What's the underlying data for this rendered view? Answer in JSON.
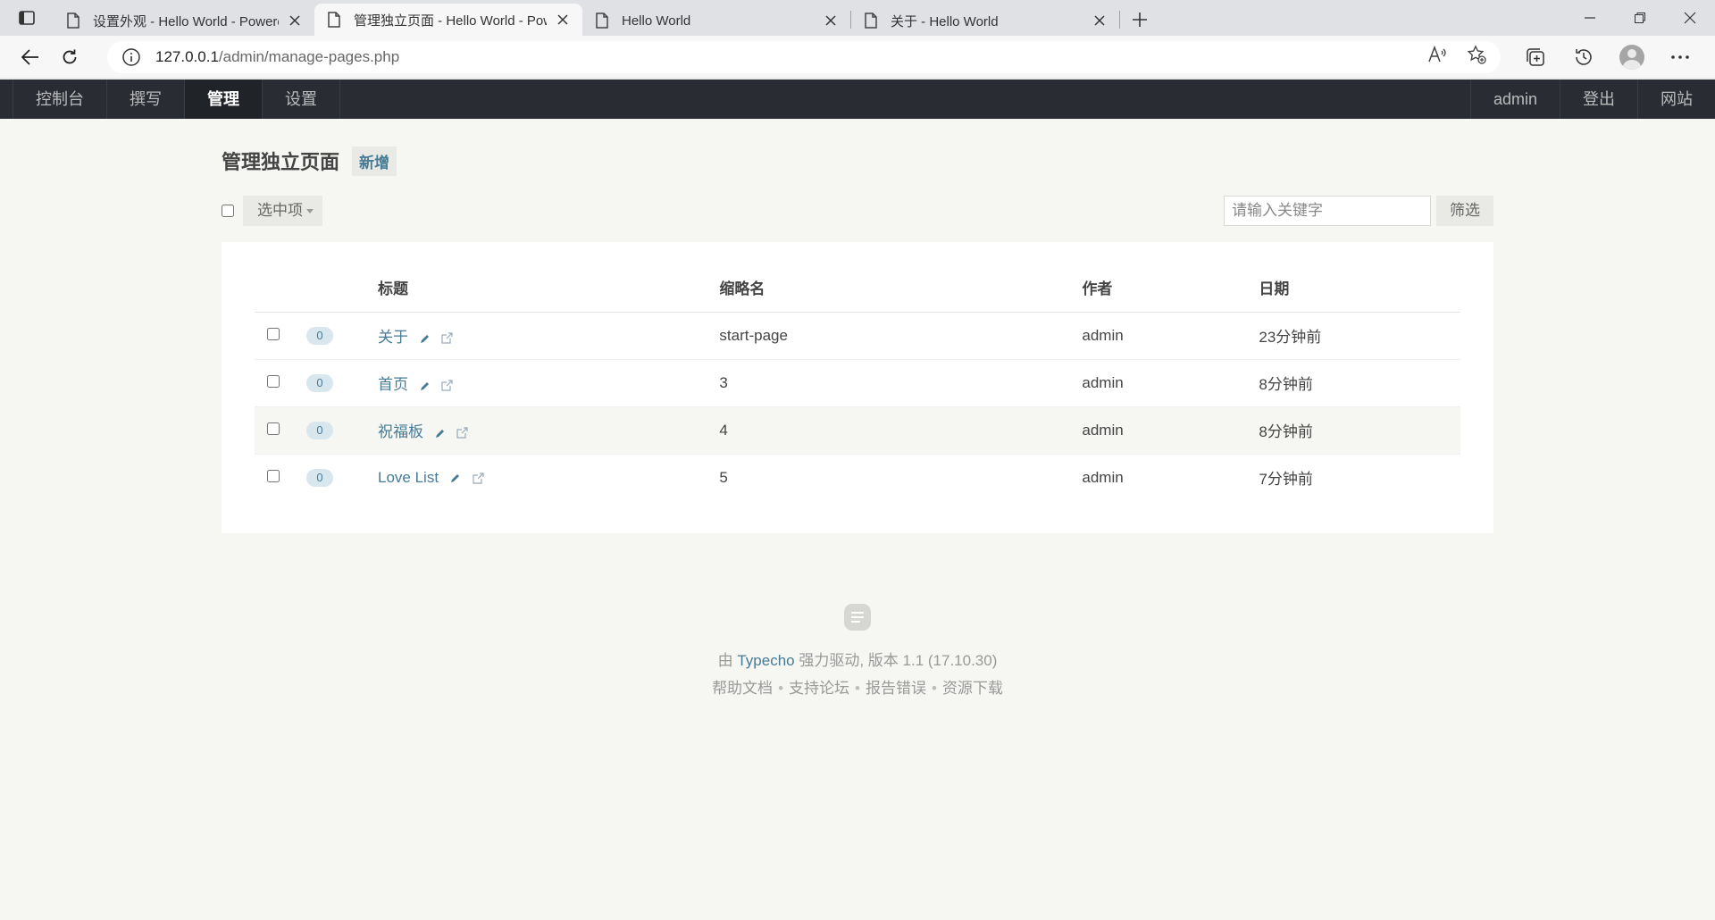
{
  "browser": {
    "tabs": [
      {
        "title": "设置外观 - Hello World - Powered by Typecho",
        "active": false
      },
      {
        "title": "管理独立页面 - Hello World - Powered by Typecho",
        "active": true
      },
      {
        "title": "Hello World",
        "active": false
      },
      {
        "title": "关于 - Hello World",
        "active": false
      }
    ],
    "url_host": "127.0.0.1",
    "url_path": "/admin/manage-pages.php"
  },
  "adminnav": {
    "left": [
      "控制台",
      "撰写",
      "管理",
      "设置"
    ],
    "active": "管理",
    "right": [
      "admin",
      "登出",
      "网站"
    ]
  },
  "page": {
    "title": "管理独立页面",
    "add_label": "新增",
    "selected_label": "选中项",
    "search_placeholder": "请输入关键字",
    "filter_label": "筛选"
  },
  "table": {
    "headers": {
      "title": "标题",
      "slug": "缩略名",
      "author": "作者",
      "date": "日期"
    },
    "rows": [
      {
        "count": "0",
        "title": "关于",
        "slug": "start-page",
        "author": "admin",
        "date": "23分钟前"
      },
      {
        "count": "0",
        "title": "首页",
        "slug": "3",
        "author": "admin",
        "date": "8分钟前"
      },
      {
        "count": "0",
        "title": "祝福板",
        "slug": "4",
        "author": "admin",
        "date": "8分钟前"
      },
      {
        "count": "0",
        "title": "Love List",
        "slug": "5",
        "author": "admin",
        "date": "7分钟前"
      }
    ]
  },
  "footer": {
    "prefix": "由",
    "brand": "Typecho",
    "suffix": "强力驱动, 版本 1.1 (17.10.30)",
    "links": [
      "帮助文档",
      "支持论坛",
      "报告错误",
      "资源下载"
    ]
  },
  "colors": {
    "accent": "#467b96",
    "nav_bg": "#292d33",
    "page_bg": "#f6f6f3"
  }
}
